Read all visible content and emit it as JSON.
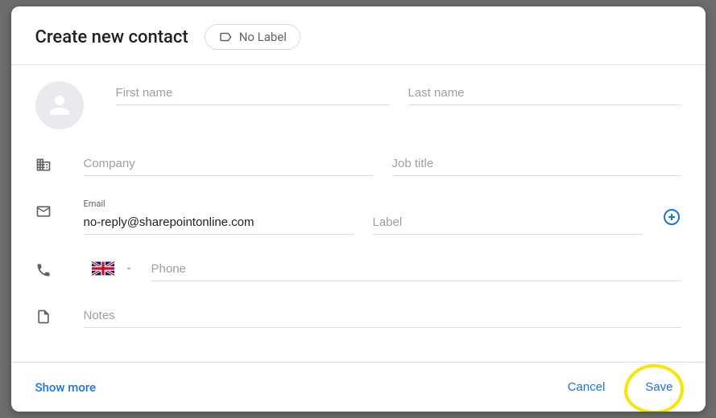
{
  "header": {
    "title": "Create new contact",
    "label_chip": "No Label"
  },
  "fields": {
    "first_name": {
      "placeholder": "First name",
      "value": ""
    },
    "last_name": {
      "placeholder": "Last name",
      "value": ""
    },
    "company": {
      "placeholder": "Company",
      "value": ""
    },
    "job_title": {
      "placeholder": "Job title",
      "value": ""
    },
    "email": {
      "label": "Email",
      "value": "no-reply@sharepointonline.com"
    },
    "email_label": {
      "placeholder": "Label",
      "value": ""
    },
    "phone": {
      "placeholder": "Phone",
      "value": "",
      "country": "UK"
    },
    "notes": {
      "placeholder": "Notes",
      "value": ""
    }
  },
  "footer": {
    "show_more": "Show more",
    "cancel": "Cancel",
    "save": "Save"
  }
}
